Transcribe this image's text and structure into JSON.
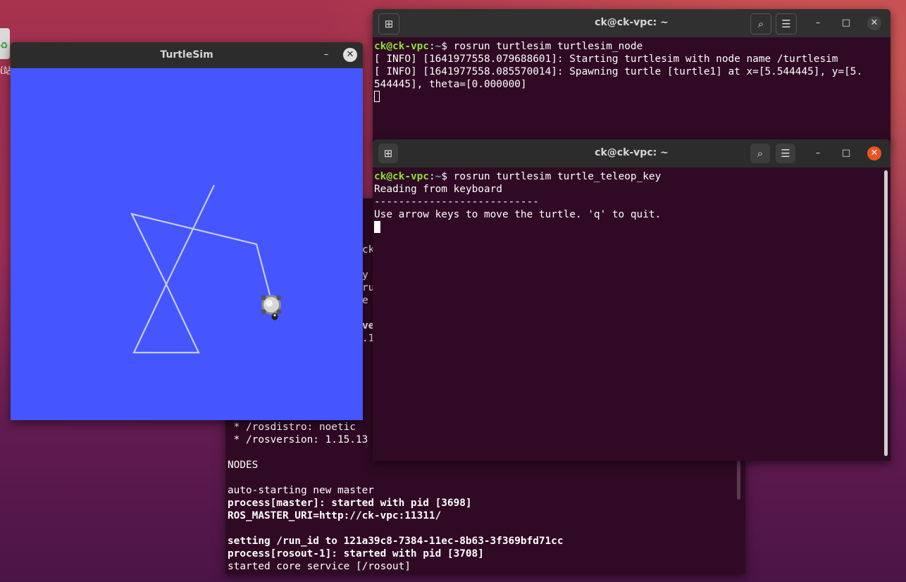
{
  "desktop": {
    "trash_label": "垃圾桶",
    "trash_label_visible": "ί站"
  },
  "roscore_terminal": {
    "partial_lines": [
      "ck",
      "y",
      "ru",
      "e",
      "ve",
      ".1"
    ],
    "lines": [
      " * /rosdistro: noetic",
      " * /rosversion: 1.15.13",
      "",
      "NODES",
      "",
      "auto-starting new master",
      "process[master]: started with pid [3698]",
      "ROS_MASTER_URI=http://ck-vpc:11311/",
      "",
      "setting /run_id to 121a39c8-7384-11ec-8b63-3f369bfd71cc",
      "process[rosout-1]: started with pid [3708]",
      "started core service [/rosout]"
    ],
    "bold_lines": [
      6,
      7,
      9,
      10
    ]
  },
  "turtlesim": {
    "title": "TurtleSim",
    "minimize": "–",
    "close": "✕",
    "background_color": "#4556ff",
    "path_color": "#c7cbee"
  },
  "node_terminal": {
    "title": "ck@ck-vpc: ~",
    "new_tab_icon": "new-tab-icon",
    "prompt_user": "ck@ck-vpc",
    "prompt_sep": ":",
    "prompt_path": "~",
    "prompt_dollar": "$",
    "command": " rosrun turtlesim turtlesim_node",
    "output": [
      "[ INFO] [1641977558.079688601]: Starting turtlesim with node name /turtlesim",
      "[ INFO] [1641977558.085570014]: Spawning turtle [turtle1] at x=[5.544445], y=[5.",
      "544445], theta=[0.000000]"
    ]
  },
  "teleop_terminal": {
    "title": "ck@ck-vpc: ~",
    "prompt_user": "ck@ck-vpc",
    "prompt_sep": ":",
    "prompt_path": "~",
    "prompt_dollar": "$",
    "command": " rosrun turtlesim turtle_teleop_key",
    "output": [
      "Reading from keyboard",
      "---------------------------",
      "Use arrow keys to move the turtle. 'q' to quit."
    ]
  },
  "controls": {
    "minimize": "–",
    "maximize": "□",
    "close": "✕",
    "search": "⌕",
    "menu": "☰",
    "new_tab": "⊞"
  }
}
